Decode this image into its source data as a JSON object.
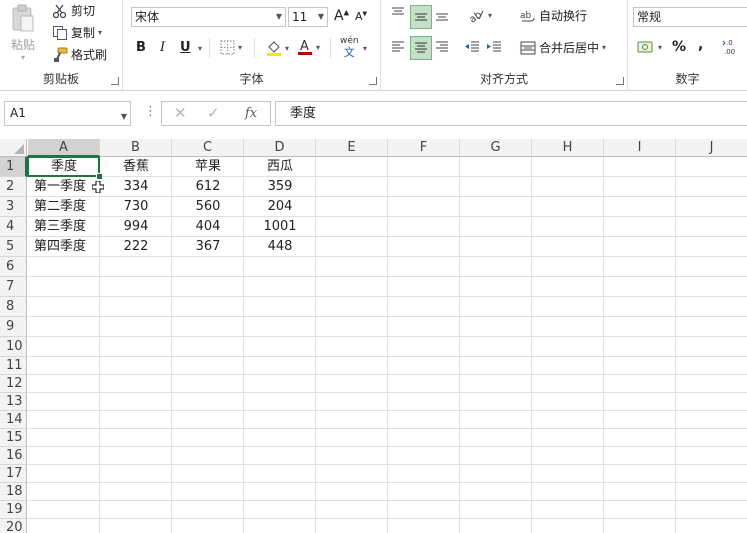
{
  "ribbon": {
    "clipboard": {
      "paste": "粘贴",
      "cut": "剪切",
      "copy": "复制",
      "format_painter": "格式刷",
      "label": "剪贴板"
    },
    "font": {
      "font_name": "宋体",
      "font_size": "11",
      "bold": "B",
      "italic": "I",
      "underline": "U",
      "phonetic": "wén",
      "phonetic_sub": "文",
      "label": "字体",
      "fill_color": "#FFE900",
      "font_color": "#C00000"
    },
    "alignment": {
      "wrap_text": "自动换行",
      "merge_center": "合并后居中",
      "label": "对齐方式"
    },
    "number": {
      "format": "常规",
      "percent": "%",
      "comma": ",",
      "label": "数字"
    }
  },
  "formula_bar": {
    "name_box": "A1",
    "fx": "fx",
    "content": "季度"
  },
  "grid": {
    "columns": [
      "A",
      "B",
      "C",
      "D",
      "E",
      "F",
      "G",
      "H",
      "I",
      "J"
    ],
    "rows": [
      "1",
      "2",
      "3",
      "4",
      "5",
      "6",
      "7",
      "8",
      "9",
      "10",
      "11",
      "12",
      "13",
      "14",
      "15",
      "16",
      "17",
      "18",
      "19",
      "20"
    ],
    "data": [
      [
        "季度",
        "香蕉",
        "苹果",
        "西瓜"
      ],
      [
        "第一季度",
        "334",
        "612",
        "359"
      ],
      [
        "第二季度",
        "730",
        "560",
        "204"
      ],
      [
        "第三季度",
        "994",
        "404",
        "1001"
      ],
      [
        "第四季度",
        "222",
        "367",
        "448"
      ]
    ],
    "selection_color": "#217346"
  }
}
